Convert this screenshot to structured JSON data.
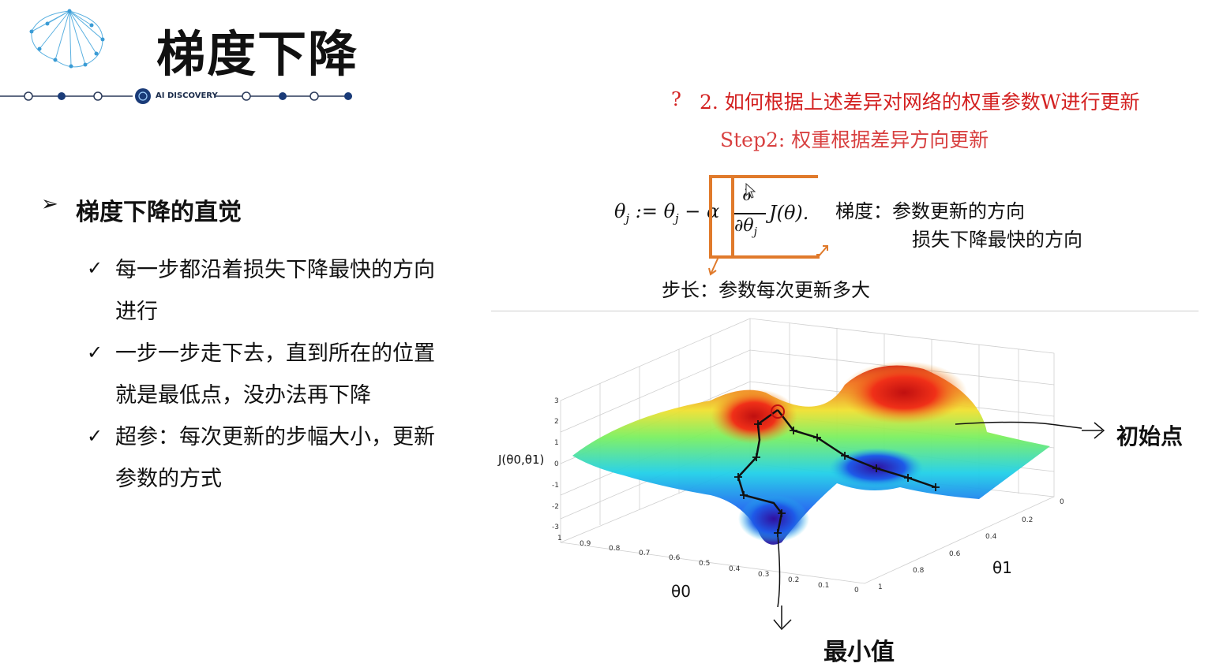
{
  "header": {
    "title": "梯度下降",
    "brand": "AI DISCOVERY"
  },
  "left": {
    "heading": "梯度下降的直觉",
    "bullets": [
      {
        "line1": "每一步都沿着损失下降最快的方向",
        "line2": "进行"
      },
      {
        "line1": "一步一步走下去，直到所在的位置",
        "line2": "就是最低点，没办法再下降"
      },
      {
        "line1": "超参：每次更新的步幅大小，更新",
        "line2": "参数的方式"
      }
    ]
  },
  "right": {
    "question_mark": "?",
    "question": "2. 如何根据上述差异对网络的权重参数W进行更新",
    "step": "Step2: 权重根据差异方向更新",
    "formula": {
      "lhs": "θ",
      "sub": "j",
      "assign": " := θ",
      "minus": " − α",
      "partial": "∂",
      "den": "∂θ",
      "rhs": "J(θ)."
    },
    "gradient_label": "梯度：参数更新的方向",
    "gradient_note": "损失下降最快的方向",
    "step_label": "步长：参数每次更新多大"
  },
  "plot": {
    "z_label": "J(θ0,θ1)",
    "x_label": "θ0",
    "y_label": "θ1",
    "z_ticks": [
      "3",
      "2",
      "1",
      "0",
      "-1",
      "-2",
      "-3"
    ],
    "x_ticks": [
      "1",
      "0.9",
      "0.8",
      "0.7",
      "0.6",
      "0.5",
      "0.4",
      "0.3",
      "0.2",
      "0.1",
      "0"
    ],
    "y_ticks": [
      "0",
      "0.2",
      "0.4",
      "0.6",
      "0.8",
      "1"
    ],
    "start_label": "初始点",
    "min_label": "最小值"
  },
  "colors": {
    "accent_red": "#d32020",
    "highlight_orange": "#e07a2b",
    "logo_blue": "#3a9bd5"
  }
}
